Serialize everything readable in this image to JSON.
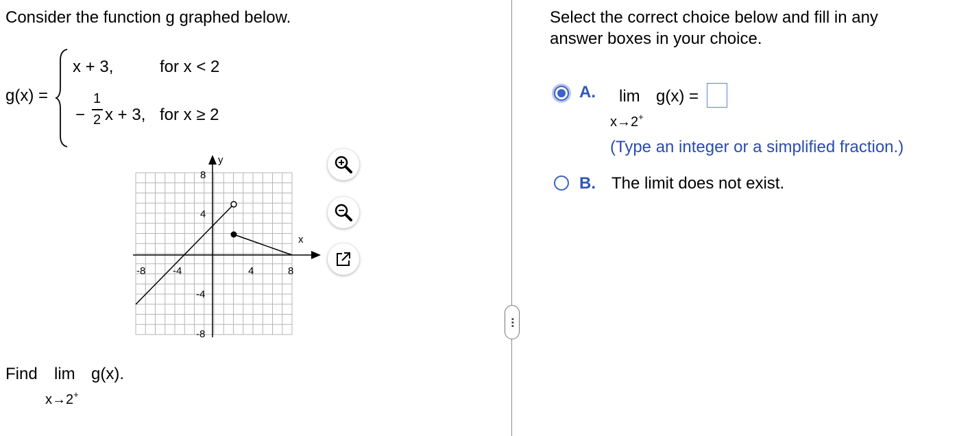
{
  "left": {
    "intro": "Consider the function g graphed below.",
    "func_name": "g(x) =",
    "piece1_expr": "x + 3,",
    "piece1_cond": "for x < 2",
    "piece2_num": "1",
    "piece2_den": "2",
    "piece2_minus": "−",
    "piece2_rest": "x + 3,",
    "piece2_cond": "for x ≥ 2",
    "find_word": "Find",
    "lim_word": "lim",
    "lim_func": "g(x).",
    "lim_sub": "x→2",
    "lim_sup": "+"
  },
  "graph": {
    "x_axis_label": "x",
    "y_axis_label": "y",
    "tick_labels": {
      "x_neg8": "-8",
      "x_neg4": "-4",
      "x_4": "4",
      "x_8": "8",
      "y_8": "8",
      "y_4": "4",
      "y_neg4": "-4",
      "y_neg8": "-8"
    },
    "tools": {
      "zoom_in": "zoom-in-icon",
      "zoom_out": "zoom-out-icon",
      "popout": "external-link-icon"
    }
  },
  "right": {
    "instruction_line1": "Select the correct choice below and fill in any",
    "instruction_line2": "answer boxes in your choice.",
    "choice_a_letter": "A.",
    "choice_a_lim": "lim",
    "choice_a_func": "g(x) =",
    "choice_a_sub": "x→2",
    "choice_a_sup": "+",
    "choice_a_hint": "(Type an integer or a simplified fraction.)",
    "choice_a_answer": "",
    "choice_b_letter": "B.",
    "choice_b_text": "The limit does not exist.",
    "selected_choice": "A"
  },
  "colors": {
    "accent": "#3a62c8",
    "hint": "#2a4cb0",
    "answer_border": "#5b86d6"
  }
}
